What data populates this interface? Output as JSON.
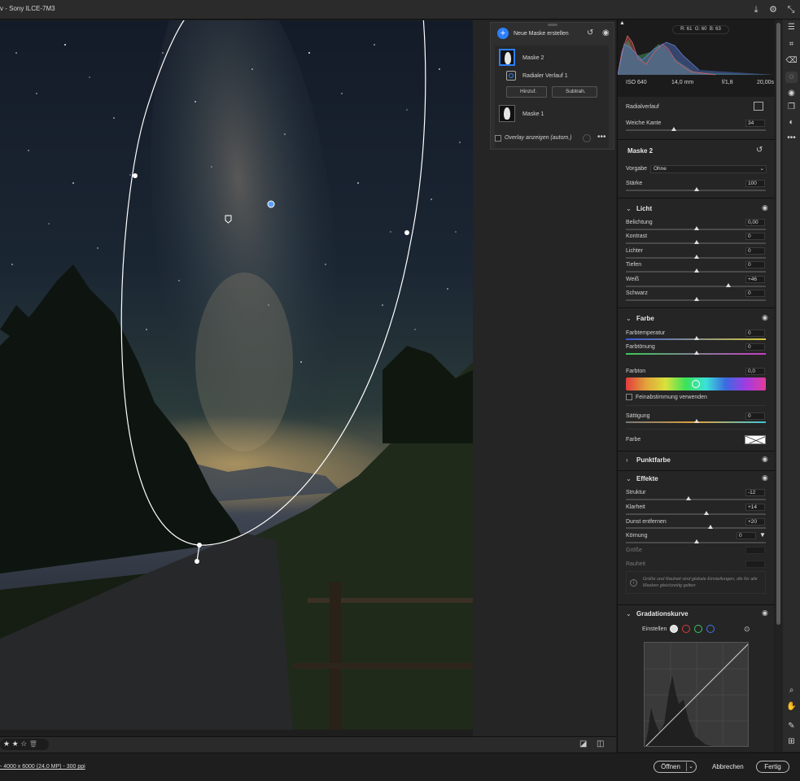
{
  "window": {
    "title": "v - Sony ILCE-7M3"
  },
  "topbar_icons": [
    "download-icon",
    "gear-icon",
    "collapse-icon"
  ],
  "masks_panel": {
    "new_mask_label": "Neue Maske erstellen",
    "masks": [
      {
        "name": "Maske 2",
        "selected": true,
        "components": [
          {
            "name": "Radialer Verlauf 1"
          }
        ]
      },
      {
        "name": "Maske 1",
        "selected": false
      }
    ],
    "add_label": "Hinzuf.",
    "subtract_label": "Subtrah.",
    "overlay_label": "Overlay anzeigen (autom.)"
  },
  "histogram": {
    "r": "R: 61",
    "g": "G: 60",
    "b": "B: 63",
    "iso": "ISO 640",
    "focal": "14,0 mm",
    "aperture": "f/1,8",
    "shutter": "20,00s"
  },
  "radial": {
    "title": "Radialverlauf",
    "feather_label": "Weiche Kante",
    "feather_value": "34"
  },
  "mask_settings": {
    "title": "Maske 2",
    "preset_label": "Vorgabe",
    "preset_value": "Ohne",
    "amount_label": "Stärke",
    "amount_value": "100"
  },
  "light": {
    "title": "Licht",
    "sliders": [
      {
        "label": "Belichtung",
        "value": "0,00"
      },
      {
        "label": "Kontrast",
        "value": "0"
      },
      {
        "label": "Lichter",
        "value": "0"
      },
      {
        "label": "Tiefen",
        "value": "0"
      },
      {
        "label": "Weiß",
        "value": "+46"
      },
      {
        "label": "Schwarz",
        "value": "0"
      }
    ]
  },
  "color": {
    "title": "Farbe",
    "temp_label": "Farbtemperatur",
    "temp_value": "0",
    "tint_label": "Farbtönung",
    "tint_value": "0",
    "hue_label": "Farbton",
    "hue_value": "0,0",
    "fine_label": "Feinabstimmung verwenden",
    "sat_label": "Sättigung",
    "sat_value": "0",
    "color_label": "Farbe"
  },
  "point_color": {
    "title": "Punktfarbe"
  },
  "effects": {
    "title": "Effekte",
    "sliders": [
      {
        "label": "Struktur",
        "value": "-12"
      },
      {
        "label": "Klarheit",
        "value": "+14"
      },
      {
        "label": "Dunst entfernen",
        "value": "+20"
      },
      {
        "label": "Körnung",
        "value": "0"
      }
    ],
    "size_label": "Größe",
    "roughness_label": "Rauheit",
    "note": "Größe und Rauheit sind globale Einstellungen, die für alle Masken gleichzeitig gelten"
  },
  "curve": {
    "title": "Gradationskurve",
    "adjust_label": "Einstellen"
  },
  "bottom": {
    "info": "- 4000 x 6000 (24,0 MP) - 300 ppi",
    "open_label": "Öffnen",
    "cancel_label": "Abbrechen",
    "done_label": "Fertig"
  },
  "rating": {
    "stars": 3
  },
  "colors": {
    "accent": "#2d7ff9",
    "panel": "#252525",
    "background": "#1e1e1e"
  }
}
